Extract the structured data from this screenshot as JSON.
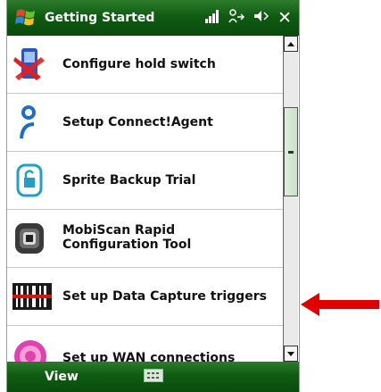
{
  "title_bar": {
    "title": "Getting Started",
    "icons": [
      "windows-start-icon",
      "signal-strength-icon",
      "connectivity-icon",
      "volume-icon",
      "close-icon"
    ],
    "close_glyph": "✕"
  },
  "list": {
    "items": [
      {
        "label": "Configure hold switch",
        "icon": "hold-switch-icon"
      },
      {
        "label": "Setup Connect!Agent",
        "icon": "connect-agent-icon"
      },
      {
        "label": "Sprite Backup Trial",
        "icon": "backup-lock-icon"
      },
      {
        "label": "MobiScan Rapid\nConfiguration Tool",
        "icon": "mobiscan-icon"
      },
      {
        "label": "Set up Data Capture triggers",
        "icon": "barcode-icon"
      },
      {
        "label": "Set up WAN connections",
        "icon": "wan-icon"
      }
    ]
  },
  "softkey_bar": {
    "left_label": "View",
    "center_icon": "keyboard-icon"
  },
  "annotation": {
    "arrow_color": "#e00000",
    "arrow_icon": "red-arrow-icon"
  },
  "colors": {
    "bar_green": "#0f5c12",
    "scroll_thumb": "#c8e0c6"
  }
}
